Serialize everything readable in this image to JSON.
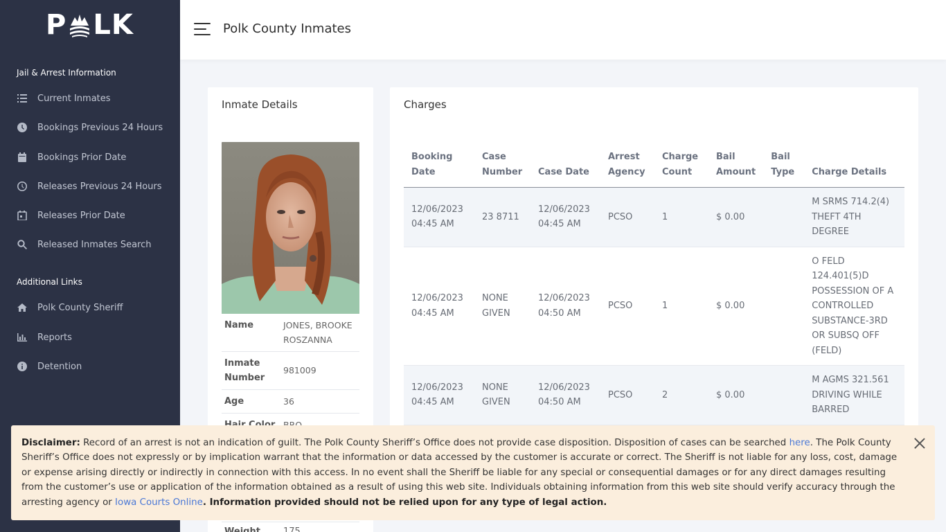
{
  "app": {
    "logo_text_left": "P",
    "logo_text_right": "LK",
    "header_title": "Polk County Inmates"
  },
  "sidebar": {
    "section1": "Jail & Arrest Information",
    "items1": [
      {
        "label": "Current Inmates",
        "icon": "list-icon"
      },
      {
        "label": "Bookings Previous 24 Hours",
        "icon": "clock-icon"
      },
      {
        "label": "Bookings Prior Date",
        "icon": "calendar-icon"
      },
      {
        "label": "Releases Previous 24 Hours",
        "icon": "clock-outline-icon"
      },
      {
        "label": "Releases Prior Date",
        "icon": "calendar-check-icon"
      },
      {
        "label": "Released Inmates Search",
        "icon": "search-icon"
      }
    ],
    "section2": "Additional Links",
    "items2": [
      {
        "label": "Polk County Sheriff",
        "icon": "home-icon"
      },
      {
        "label": "Reports",
        "icon": "bar-chart-icon"
      },
      {
        "label": "Detention",
        "icon": "info-icon"
      }
    ]
  },
  "inmate": {
    "title": "Inmate Details",
    "fields": [
      {
        "k": "Name",
        "v": "JONES, BROOKE ROSZANNA"
      },
      {
        "k": "Inmate Number",
        "v": "981009"
      },
      {
        "k": "Age",
        "v": "36"
      },
      {
        "k": "Hair Color",
        "v": "BRO"
      },
      {
        "k": "Weight",
        "v": "175"
      }
    ]
  },
  "charges": {
    "title": "Charges",
    "headers": [
      "Booking Date",
      "Case Number",
      "Case Date",
      "Arrest Agency",
      "Charge Count",
      "Bail Amount",
      "Bail Type",
      "Charge Details"
    ],
    "rows": [
      [
        "12/06/2023 04:45 AM",
        "23 8711",
        "12/06/2023 04:45 AM",
        "PCSO",
        "1",
        "$ 0.00",
        "",
        "M SRMS 714.2(4) THEFT 4TH DEGREE"
      ],
      [
        "12/06/2023 04:45 AM",
        "NONE GIVEN",
        "12/06/2023 04:50 AM",
        "PCSO",
        "1",
        "$ 0.00",
        "",
        "O FELD 124.401(5)D POSSESSION OF A CONTROLLED SUBSTANCE-3RD OR SUBSQ OFF (FELD)"
      ],
      [
        "12/06/2023 04:45 AM",
        "NONE GIVEN",
        "12/06/2023 04:50 AM",
        "PCSO",
        "2",
        "$ 0.00",
        "",
        "M AGMS 321.561 DRIVING WHILE BARRED"
      ]
    ]
  },
  "disclaimer": {
    "label": "Disclaimer:",
    "text1": " Record of an arrest is not an indication of guilt. The Polk County Sheriff’s Office does not provide case disposition. Disposition of cases can be searched ",
    "link1": "here",
    "text2": ". The Polk County Sheriff’s Office does not expressly or by implication warrant that the information or data accessed by the customer is accurate or correct. The Sheriff is not liable for any loss, cost, damage or expense arising directly or indirectly in connection with this access. In no event shall the Sheriff be liable for any special or consequential damages or for any direct damages resulting from the customer’s use or application of the information obtained as a result of using this web site. Individuals obtaining information from this web site should verify accuracy through the arresting agency or ",
    "link2": "Iowa Courts Online",
    "bold_end": ". Information provided should not be relied upon for any type of legal action."
  }
}
